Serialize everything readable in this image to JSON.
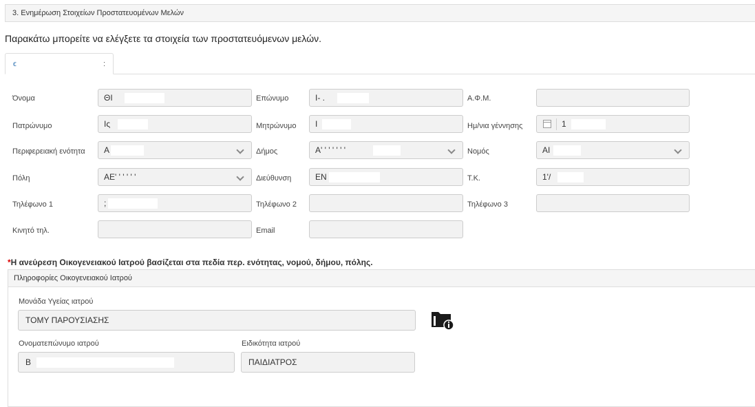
{
  "section": {
    "title": "3. Ενημέρωση Στοιχείων Προστατευομένων Μελών"
  },
  "intro": "Παρακάτω μπορείτε να ελέγξετε τα στοιχεία των προστατευόμενων μελών.",
  "tab": {
    "label_main": "ϵ",
    "label_end": ":"
  },
  "form": {
    "onoma": {
      "label": "Όνομα",
      "value": "ΘΙ"
    },
    "eponymo": {
      "label": "Επώνυμο",
      "value": "Ι- ."
    },
    "afm": {
      "label": "Α.Φ.Μ.",
      "value": ""
    },
    "patronymo": {
      "label": "Πατρώνυμο",
      "value": "Ις"
    },
    "mitronymo": {
      "label": "Μητρώνυμο",
      "value": "Ι"
    },
    "birth": {
      "label": "Ημ/νια γέννησης",
      "value": "1"
    },
    "perifereia": {
      "label": "Περιφερειακή ενότητα",
      "value": "Α"
    },
    "dimos": {
      "label": "Δήμος",
      "value": "Α' ' ' ' ' ' '"
    },
    "nomos": {
      "label": "Νομός",
      "value": "ΑΙ"
    },
    "poli": {
      "label": "Πόλη",
      "value": "ΑΕ' ' ' ' ' '"
    },
    "dieuthinsi": {
      "label": "Διεύθυνση",
      "value": "ΕΝ"
    },
    "tk": {
      "label": "Τ.Κ.",
      "value": "1'/"
    },
    "tel1": {
      "label": "Τηλέφωνο 1",
      "value": ";"
    },
    "tel2": {
      "label": "Τηλέφωνο 2",
      "value": ""
    },
    "tel3": {
      "label": "Τηλέφωνο 3",
      "value": ""
    },
    "kinito": {
      "label": "Κινητό τηλ.",
      "value": ""
    },
    "email": {
      "label": "Email",
      "value": ""
    }
  },
  "note": {
    "star": "*",
    "text": "Η ανεύρεση Οικογενειακού Ιατρού βασίζεται στα πεδία περ. ενότητας, νομού, δήμου, πόλης."
  },
  "doctor": {
    "panel_title": "Πληροφορίες Οικογενειακού Ιατρού",
    "unit_label": "Μονάδα Υγείας ιατρού",
    "unit_value": "ΤΟΜΥ ΠΑΡΟΥΣΙΑΣΗΣ",
    "name_label": "Ονοματεπώνυμο ιατρού",
    "name_value": "Β",
    "specialty_label": "Ειδικότητα ιατρού",
    "specialty_value": "ΠΑΙΔΙΑΤΡΟΣ"
  },
  "icons": {
    "calendar": "calendar-icon",
    "chevron": "chevron-down-icon",
    "folder": "folder-info-icon"
  }
}
